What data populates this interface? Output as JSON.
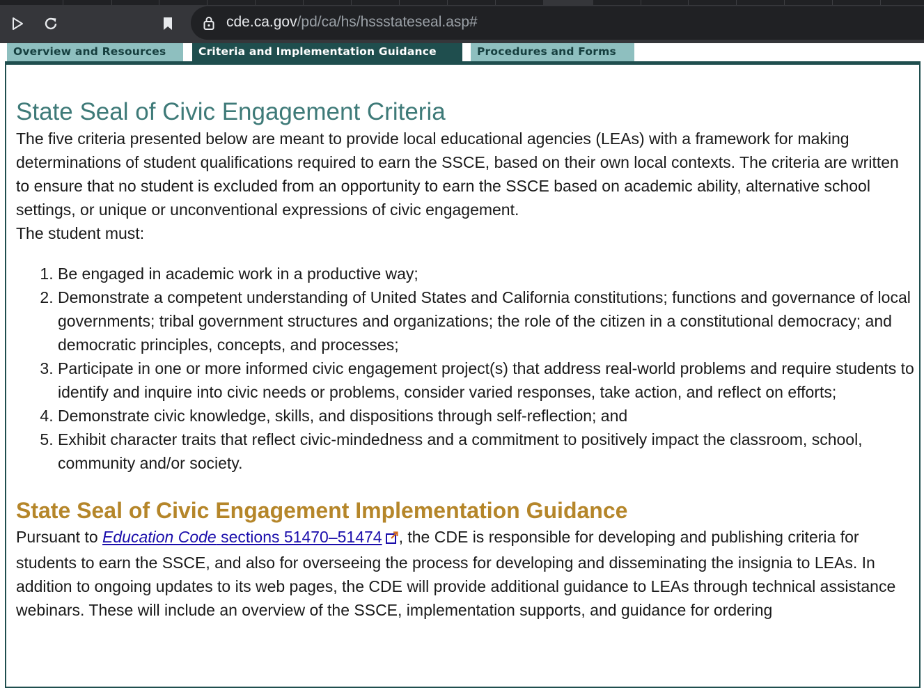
{
  "browser": {
    "url_domain": "cde.ca.gov",
    "url_path": "/pd/ca/hs/hssstateseal.asp#"
  },
  "tabs": [
    {
      "label": "Overview and Resources",
      "active": false
    },
    {
      "label": "Criteria and Implementation Guidance",
      "active": true
    },
    {
      "label": "Procedures and Forms",
      "active": false
    }
  ],
  "criteria": {
    "title": "State Seal of Civic Engagement Criteria",
    "intro": "The five criteria presented below are meant to provide local educational agencies (LEAs) with a framework for making determinations of student qualifications required to earn the SSCE, based on their own local contexts. The criteria are written to ensure that no student is excluded from an opportunity to earn the SSCE based on academic ability, alternative school settings, or unique or unconventional expressions of civic engagement.",
    "lead": "The student must:",
    "items": [
      "Be engaged in academic work in a productive way;",
      "Demonstrate a competent understanding of United States and California constitutions; functions and governance of local governments; tribal government structures and organizations; the role of the citizen in a constitutional democracy; and democratic principles, concepts, and processes;",
      "Participate in one or more informed civic engagement project(s) that address real-world problems and require students to identify and inquire into civic needs or problems, consider varied responses, take action, and reflect on efforts;",
      "Demonstrate civic knowledge, skills, and dispositions through self-reflection; and",
      "Exhibit character traits that reflect civic-mindedness and a commitment to positively impact the classroom, school, community and/or society."
    ]
  },
  "implementation": {
    "title": "State Seal of Civic Engagement Implementation Guidance",
    "prefix": "Pursuant to ",
    "link_italic": "Education Code",
    "link_rest": " sections 51470–51474",
    "suffix": ", the CDE is responsible for developing and publishing criteria for students to earn the SSCE, and also for overseeing the process for developing and disseminating the insignia to LEAs. In addition to ongoing updates to its web pages, the CDE will provide additional guidance to LEAs through technical assistance webinars. These will include an overview of the SSCE, implementation supports, and guidance for ordering"
  },
  "colors": {
    "criteria_title": "#3e7a78",
    "impl_title": "#b5862a",
    "tab_active": "#1f4e4e",
    "tab_inactive": "#8ebfbf",
    "link": "#1a0dab"
  }
}
